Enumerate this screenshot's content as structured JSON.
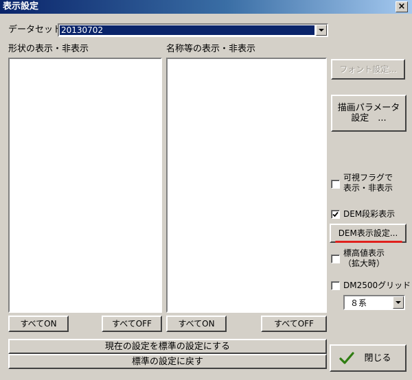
{
  "window": {
    "title": "表示設定",
    "close_glyph": "×"
  },
  "dataset": {
    "label": "データセット",
    "selected": "20130702"
  },
  "shape_section": {
    "label": "形状の表示・非表示",
    "all_on": "すべてON",
    "all_off": "すべてOFF"
  },
  "name_section": {
    "label": "名称等の表示・非表示",
    "all_on": "すべてON",
    "all_off": "すべてOFF"
  },
  "side": {
    "font_settings": "フォント設定...",
    "draw_params_line1": "描画パラメータ",
    "draw_params_line2": "設定　...",
    "visibility_flag_line1": "可視フラグで",
    "visibility_flag_line2": "表示・非表示",
    "visibility_flag_checked": false,
    "dem_color": "DEM段彩表示",
    "dem_color_checked": true,
    "dem_settings": "DEM表示設定...",
    "elevation_line1": "標高値表示",
    "elevation_line2": "（拡大時）",
    "elevation_checked": false,
    "dm2500_grid": "DM2500グリッド",
    "dm2500_checked": false,
    "system_selected": "８系"
  },
  "bottom": {
    "set_default": "現在の設定を標準の設定にする",
    "restore_default": "標準の設定に戻す",
    "close": "閉じる"
  },
  "colors": {
    "titlebar": "#0a246a",
    "face": "#d4d0c8",
    "highlight_underline": "#e0201c",
    "check_icon": "#2f7d12"
  }
}
